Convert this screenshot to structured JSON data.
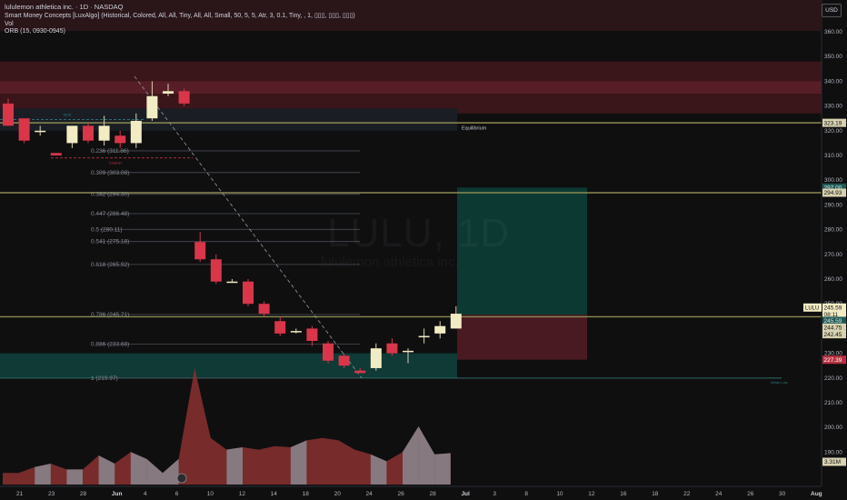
{
  "header": {
    "title": "lululemon athletica inc. · 1D · NASDAQ",
    "indicator_smc": "Smart Money Concepts [LuxAlgo] (Historical, Colored, All, All, Tiny, All, All, Small, 50, 5, 5, Atr, 3, 0.1, Tiny, , 1, ▯▯▯, ▯▯▯, ▯▯▯)",
    "indicator_vol": "Vol",
    "indicator_orb": "ORB (15, 0930-0945)"
  },
  "currency_button": "USD",
  "watermark": {
    "symbol": "LULU, 1D",
    "name": "lululemon athletica inc."
  },
  "price_axis": {
    "ticks": [
      "360.00",
      "350.00",
      "340.00",
      "330.00",
      "320.00",
      "310.00",
      "300.00",
      "290.00",
      "280.00",
      "270.00",
      "260.00",
      "250.00",
      "240.00",
      "230.00",
      "220.00",
      "210.00",
      "200.00",
      "190.00"
    ],
    "tick_values": [
      360,
      350,
      340,
      330,
      320,
      310,
      300,
      290,
      280,
      270,
      260,
      250,
      240,
      230,
      220,
      210,
      200,
      190
    ]
  },
  "time_axis": {
    "labels": [
      "21",
      "23",
      "28",
      "Jun",
      "4",
      "6",
      "10",
      "12",
      "14",
      "18",
      "20",
      "24",
      "26",
      "28",
      "Jul",
      "3",
      "8",
      "10",
      "12",
      "16",
      "18",
      "22",
      "24",
      "26",
      "30",
      "Aug"
    ]
  },
  "price_badges": {
    "symbol_tag": "LULU",
    "last_price": "245.59",
    "countdown": "08:11",
    "b_323": "323.19",
    "b_297": "297.00",
    "b_294": "294.93",
    "b_2456": "245.59",
    "b_2447": "244.75",
    "b_2424": "242.45",
    "b_227": "227.39",
    "volume": "3.31M"
  },
  "fib_levels": [
    {
      "label": "0.236 (311.86)",
      "price": 311.86
    },
    {
      "label": "0.309 (303.08)",
      "price": 303.08
    },
    {
      "label": "0.382 (294.30)",
      "price": 294.3
    },
    {
      "label": "0.447 (286.48)",
      "price": 286.48
    },
    {
      "label": "0.5 (280.11)",
      "price": 280.11
    },
    {
      "label": "0.541 (275.18)",
      "price": 275.18
    },
    {
      "label": "0.618 (265.92)",
      "price": 265.92
    },
    {
      "label": "0.786 (245.71)",
      "price": 245.71
    },
    {
      "label": "0.886 (233.68)",
      "price": 233.68
    },
    {
      "label": "1 (219.97)",
      "price": 219.97
    }
  ],
  "annotations": {
    "equilibrium": "Equilibrium",
    "small_label_left": "BOS",
    "small_label_choch": "CHoCH",
    "small_label_right": "Weak Low"
  },
  "chart_data": {
    "type": "candlestick",
    "symbol": "LULU",
    "timeframe": "1D",
    "exchange": "NASDAQ",
    "y_range": [
      188,
      365
    ],
    "candles": [
      {
        "o": 331,
        "h": 333,
        "l": 322,
        "c": 322
      },
      {
        "o": 325,
        "h": 325,
        "l": 315,
        "c": 316
      },
      {
        "o": 320,
        "h": 322,
        "l": 318,
        "c": 320
      },
      {
        "o": 311,
        "h": 311,
        "l": 310,
        "c": 310
      },
      {
        "o": 315,
        "h": 319,
        "l": 313,
        "c": 322
      },
      {
        "o": 322,
        "h": 323,
        "l": 315,
        "c": 316
      },
      {
        "o": 316,
        "h": 326,
        "l": 314,
        "c": 322
      },
      {
        "o": 318,
        "h": 320,
        "l": 313,
        "c": 315
      },
      {
        "o": 315,
        "h": 327,
        "l": 313,
        "c": 324
      },
      {
        "o": 325,
        "h": 340,
        "l": 324,
        "c": 334
      },
      {
        "o": 335,
        "h": 339,
        "l": 334,
        "c": 336
      },
      {
        "o": 336,
        "h": 337,
        "l": 330,
        "c": 331
      },
      {
        "o": 275,
        "h": 279,
        "l": 267,
        "c": 268
      },
      {
        "o": 268,
        "h": 270,
        "l": 258,
        "c": 259
      },
      {
        "o": 259,
        "h": 260,
        "l": 259,
        "c": 259
      },
      {
        "o": 259,
        "h": 260,
        "l": 249,
        "c": 250
      },
      {
        "o": 250,
        "h": 251,
        "l": 245,
        "c": 246
      },
      {
        "o": 243,
        "h": 245,
        "l": 237,
        "c": 238
      },
      {
        "o": 239,
        "h": 240,
        "l": 238,
        "c": 239
      },
      {
        "o": 240,
        "h": 241,
        "l": 233,
        "c": 235
      },
      {
        "o": 234,
        "h": 235,
        "l": 226,
        "c": 227
      },
      {
        "o": 229,
        "h": 230,
        "l": 224,
        "c": 225
      },
      {
        "o": 223,
        "h": 224,
        "l": 222,
        "c": 222
      },
      {
        "o": 224,
        "h": 234,
        "l": 223,
        "c": 232
      },
      {
        "o": 234,
        "h": 236,
        "l": 229,
        "c": 230
      },
      {
        "o": 231,
        "h": 232,
        "l": 226,
        "c": 231
      },
      {
        "o": 237,
        "h": 240,
        "l": 234,
        "c": 237
      },
      {
        "o": 238,
        "h": 243,
        "l": 236,
        "c": 241
      },
      {
        "o": 240,
        "h": 249,
        "l": 240,
        "c": 246
      }
    ],
    "volume_shape": [
      0.1,
      0.1,
      0.15,
      0.18,
      0.13,
      0.13,
      0.25,
      0.18,
      0.28,
      0.22,
      0.1,
      0.22,
      1.0,
      0.4,
      0.3,
      0.32,
      0.3,
      0.33,
      0.32,
      0.38,
      0.4,
      0.38,
      0.3,
      0.26,
      0.2,
      0.28,
      0.5,
      0.26,
      0.27
    ]
  },
  "colors": {
    "bull": "#f2ecc4",
    "bear": "#d9364a",
    "premium_zone": "#5a1f28",
    "discount_zone": "#0f3a36",
    "target_zone": "#0c3a33",
    "stop_zone": "#4a1a22",
    "olive_line": "#8a8a50"
  }
}
